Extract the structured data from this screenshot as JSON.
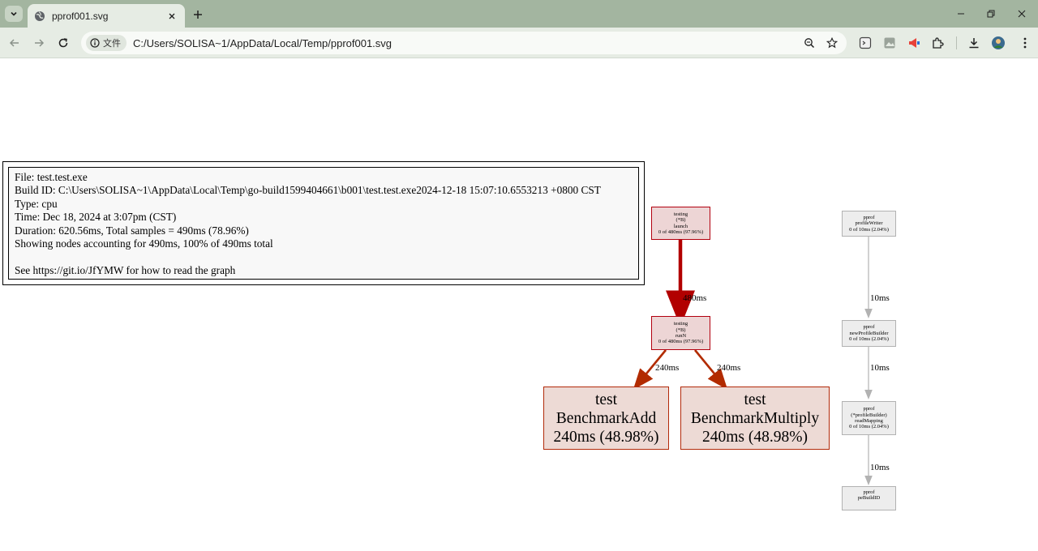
{
  "browser": {
    "tab_title": "pprof001.svg",
    "site_chip_label": "文件",
    "url": "C:/Users/SOLISA~1/AppData/Local/Temp/pprof001.svg",
    "icons": [
      "tab-list-icon",
      "globe-icon",
      "close-icon",
      "plus-icon",
      "minimize-icon",
      "restore-icon",
      "window-close-icon",
      "back-icon",
      "forward-icon",
      "reload-icon",
      "info-icon",
      "zoom-icon",
      "star-icon",
      "extension-icons",
      "download-icon",
      "profile-avatar"
    ]
  },
  "legend": {
    "file": "File: test.test.exe",
    "build_id": "Build ID: C:\\Users\\SOLISA~1\\AppData\\Local\\Temp\\go-build1599404661\\b001\\test.test.exe2024-12-18 15:07:10.6553213 +0800 CST",
    "type": "Type: cpu",
    "time": "Time: Dec 18, 2024 at 3:07pm (CST)",
    "duration": "Duration: 620.56ms, Total samples = 490ms (78.96%)",
    "showing": "Showing nodes accounting for 490ms, 100% of 490ms total",
    "see": "See https://git.io/JfYMW for how to read the graph"
  },
  "nodes": {
    "launch": {
      "l1": "testing",
      "l2": "(*B)",
      "l3": "launch",
      "l4": "0 of 480ms (97.96%)"
    },
    "runN": {
      "l1": "testing",
      "l2": "(*B)",
      "l3": "runN",
      "l4": "0 of 480ms (97.96%)"
    },
    "add": {
      "l1": "test",
      "l2": "BenchmarkAdd",
      "l3": "240ms (48.98%)"
    },
    "multiply": {
      "l1": "test",
      "l2": "BenchmarkMultiply",
      "l3": "240ms (48.98%)"
    },
    "profileWriter": {
      "l1": "pprof",
      "l2": "profileWriter",
      "l3": "0 of 10ms (2.04%)"
    },
    "newProfileBuilder": {
      "l1": "pprof",
      "l2": "newProfileBuilder",
      "l3": "0 of 10ms (2.04%)"
    },
    "readMapping": {
      "l1": "pprof",
      "l2": "(*profileBuilder)",
      "l3": "readMapping",
      "l4": "0 of 10ms (2.04%)"
    },
    "peBuildID": {
      "l1": "pprof",
      "l2": "peBuildID"
    }
  },
  "edges": {
    "launch_runN": "480ms",
    "runN_add": "240ms",
    "runN_multiply": "240ms",
    "writer_builder": "10ms",
    "builder_mapping": "10ms",
    "mapping_pe": "10ms"
  },
  "colors": {
    "hot_edge": "#b20000",
    "warm_edge": "#b22b00",
    "cold_edge": "#b2b2b2",
    "hot_node_fill": "#edd5d5",
    "big_node_fill": "#eddad5",
    "grey_node_fill": "#ededed"
  }
}
